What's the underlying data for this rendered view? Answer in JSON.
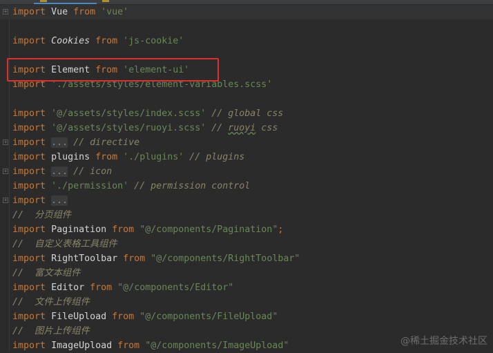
{
  "editor": {
    "lines": [
      {
        "fold": true,
        "current": true,
        "tokens": [
          [
            "kw",
            "import"
          ],
          [
            "sp",
            " "
          ],
          [
            "id",
            "Vue"
          ],
          [
            "sp",
            " "
          ],
          [
            "kw",
            "from"
          ],
          [
            "sp",
            " "
          ],
          [
            "str",
            "'vue'"
          ]
        ]
      },
      {
        "tokens": []
      },
      {
        "tokens": [
          [
            "kw",
            "import"
          ],
          [
            "sp",
            " "
          ],
          [
            "idi",
            "Cookies"
          ],
          [
            "sp",
            " "
          ],
          [
            "kw",
            "from"
          ],
          [
            "sp",
            " "
          ],
          [
            "str",
            "'js-cookie'"
          ]
        ]
      },
      {
        "tokens": []
      },
      {
        "tokens": [
          [
            "kw",
            "import"
          ],
          [
            "sp",
            " "
          ],
          [
            "id",
            "Element"
          ],
          [
            "sp",
            " "
          ],
          [
            "kw",
            "from"
          ],
          [
            "sp",
            " "
          ],
          [
            "str",
            "'element-ui'"
          ]
        ]
      },
      {
        "tokens": [
          [
            "kw",
            "import"
          ],
          [
            "sp",
            " "
          ],
          [
            "str",
            "'./assets/styles/element-variables.scss'"
          ]
        ]
      },
      {
        "tokens": []
      },
      {
        "tokens": [
          [
            "kw",
            "import"
          ],
          [
            "sp",
            " "
          ],
          [
            "str",
            "'@/assets/styles/index.scss'"
          ],
          [
            "sp",
            " "
          ],
          [
            "cmt",
            "// global css"
          ]
        ]
      },
      {
        "tokens": [
          [
            "kw",
            "import"
          ],
          [
            "sp",
            " "
          ],
          [
            "str",
            "'@/assets/styles/ruoyi.scss'"
          ],
          [
            "sp",
            " "
          ],
          [
            "cmt",
            "// "
          ],
          [
            "cmtsq",
            "ruoyi"
          ],
          [
            "cmt",
            " css"
          ]
        ]
      },
      {
        "fold": true,
        "tokens": [
          [
            "kw",
            "import"
          ],
          [
            "sp",
            " "
          ],
          [
            "dots",
            "..."
          ],
          [
            "sp",
            " "
          ],
          [
            "cmt",
            "// directive"
          ]
        ]
      },
      {
        "tokens": [
          [
            "kw",
            "import"
          ],
          [
            "sp",
            " "
          ],
          [
            "id",
            "plugins"
          ],
          [
            "sp",
            " "
          ],
          [
            "kw",
            "from"
          ],
          [
            "sp",
            " "
          ],
          [
            "str",
            "'./plugins'"
          ],
          [
            "sp",
            " "
          ],
          [
            "cmt",
            "// plugins"
          ]
        ]
      },
      {
        "fold": true,
        "tokens": [
          [
            "kw",
            "import"
          ],
          [
            "sp",
            " "
          ],
          [
            "dots",
            "..."
          ],
          [
            "sp",
            " "
          ],
          [
            "cmt",
            "// icon"
          ]
        ]
      },
      {
        "tokens": [
          [
            "kw",
            "import"
          ],
          [
            "sp",
            " "
          ],
          [
            "str",
            "'./permission'"
          ],
          [
            "sp",
            " "
          ],
          [
            "cmt",
            "// permission control"
          ]
        ]
      },
      {
        "fold": true,
        "tokens": [
          [
            "kw",
            "import"
          ],
          [
            "sp",
            " "
          ],
          [
            "dots",
            "..."
          ]
        ]
      },
      {
        "tokens": [
          [
            "cmt",
            "//  分页组件"
          ]
        ]
      },
      {
        "tokens": [
          [
            "kw",
            "import"
          ],
          [
            "sp",
            " "
          ],
          [
            "id",
            "Pagination"
          ],
          [
            "sp",
            " "
          ],
          [
            "kw",
            "from"
          ],
          [
            "sp",
            " "
          ],
          [
            "str",
            "\"@/components/Pagination\""
          ],
          [
            "punc",
            ";"
          ]
        ]
      },
      {
        "tokens": [
          [
            "cmt",
            "//  自定义表格工具组件"
          ]
        ]
      },
      {
        "tokens": [
          [
            "kw",
            "import"
          ],
          [
            "sp",
            " "
          ],
          [
            "id",
            "RightToolbar"
          ],
          [
            "sp",
            " "
          ],
          [
            "kw",
            "from"
          ],
          [
            "sp",
            " "
          ],
          [
            "str",
            "\"@/components/RightToolbar\""
          ]
        ]
      },
      {
        "tokens": [
          [
            "cmt",
            "//  富文本组件"
          ]
        ]
      },
      {
        "tokens": [
          [
            "kw",
            "import"
          ],
          [
            "sp",
            " "
          ],
          [
            "id",
            "Editor"
          ],
          [
            "sp",
            " "
          ],
          [
            "kw",
            "from"
          ],
          [
            "sp",
            " "
          ],
          [
            "str",
            "\"@/components/Editor\""
          ]
        ]
      },
      {
        "tokens": [
          [
            "cmt",
            "//  文件上传组件"
          ]
        ]
      },
      {
        "tokens": [
          [
            "kw",
            "import"
          ],
          [
            "sp",
            " "
          ],
          [
            "id",
            "FileUpload"
          ],
          [
            "sp",
            " "
          ],
          [
            "kw",
            "from"
          ],
          [
            "sp",
            " "
          ],
          [
            "str",
            "\"@/components/FileUpload\""
          ]
        ]
      },
      {
        "tokens": [
          [
            "cmt",
            "//  图片上传组件"
          ]
        ]
      },
      {
        "tokens": [
          [
            "kw",
            "import"
          ],
          [
            "sp",
            " "
          ],
          [
            "id",
            "ImageUpload"
          ],
          [
            "sp",
            " "
          ],
          [
            "kw",
            "from"
          ],
          [
            "sp",
            " "
          ],
          [
            "str",
            "\"@/components/ImageUpload\""
          ]
        ]
      }
    ]
  },
  "watermark": "@稀土掘金技术社区",
  "colors": {
    "background": "#2b2b2b",
    "keyword": "#cc7832",
    "string": "#6a8759",
    "comment": "#8a8468",
    "highlight_box": "#e0302c"
  }
}
